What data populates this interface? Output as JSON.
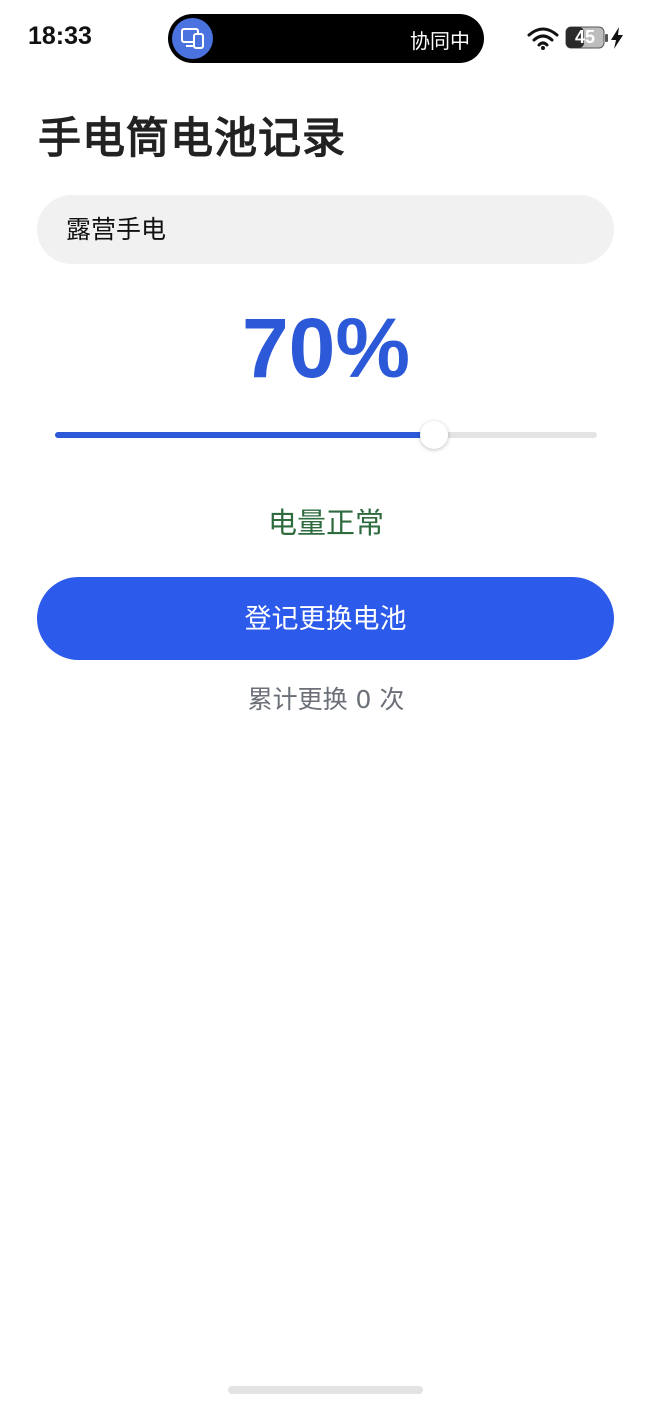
{
  "status_bar": {
    "time": "18:33",
    "island_text": "协同中",
    "battery_level": "45"
  },
  "page": {
    "title": "手电筒电池记录",
    "name_field_value": "露营手电",
    "battery_percent_text": "70%",
    "battery_level_fraction": 0.7,
    "status_text": "电量正常",
    "status_color": "#2e6b3f",
    "replace_button_label": "登记更换电池",
    "replace_count_text": "累计更换 0 次"
  },
  "colors": {
    "accent": "#2c59d8",
    "button": "#2c5aea",
    "field_bg": "#f1f1f1"
  }
}
